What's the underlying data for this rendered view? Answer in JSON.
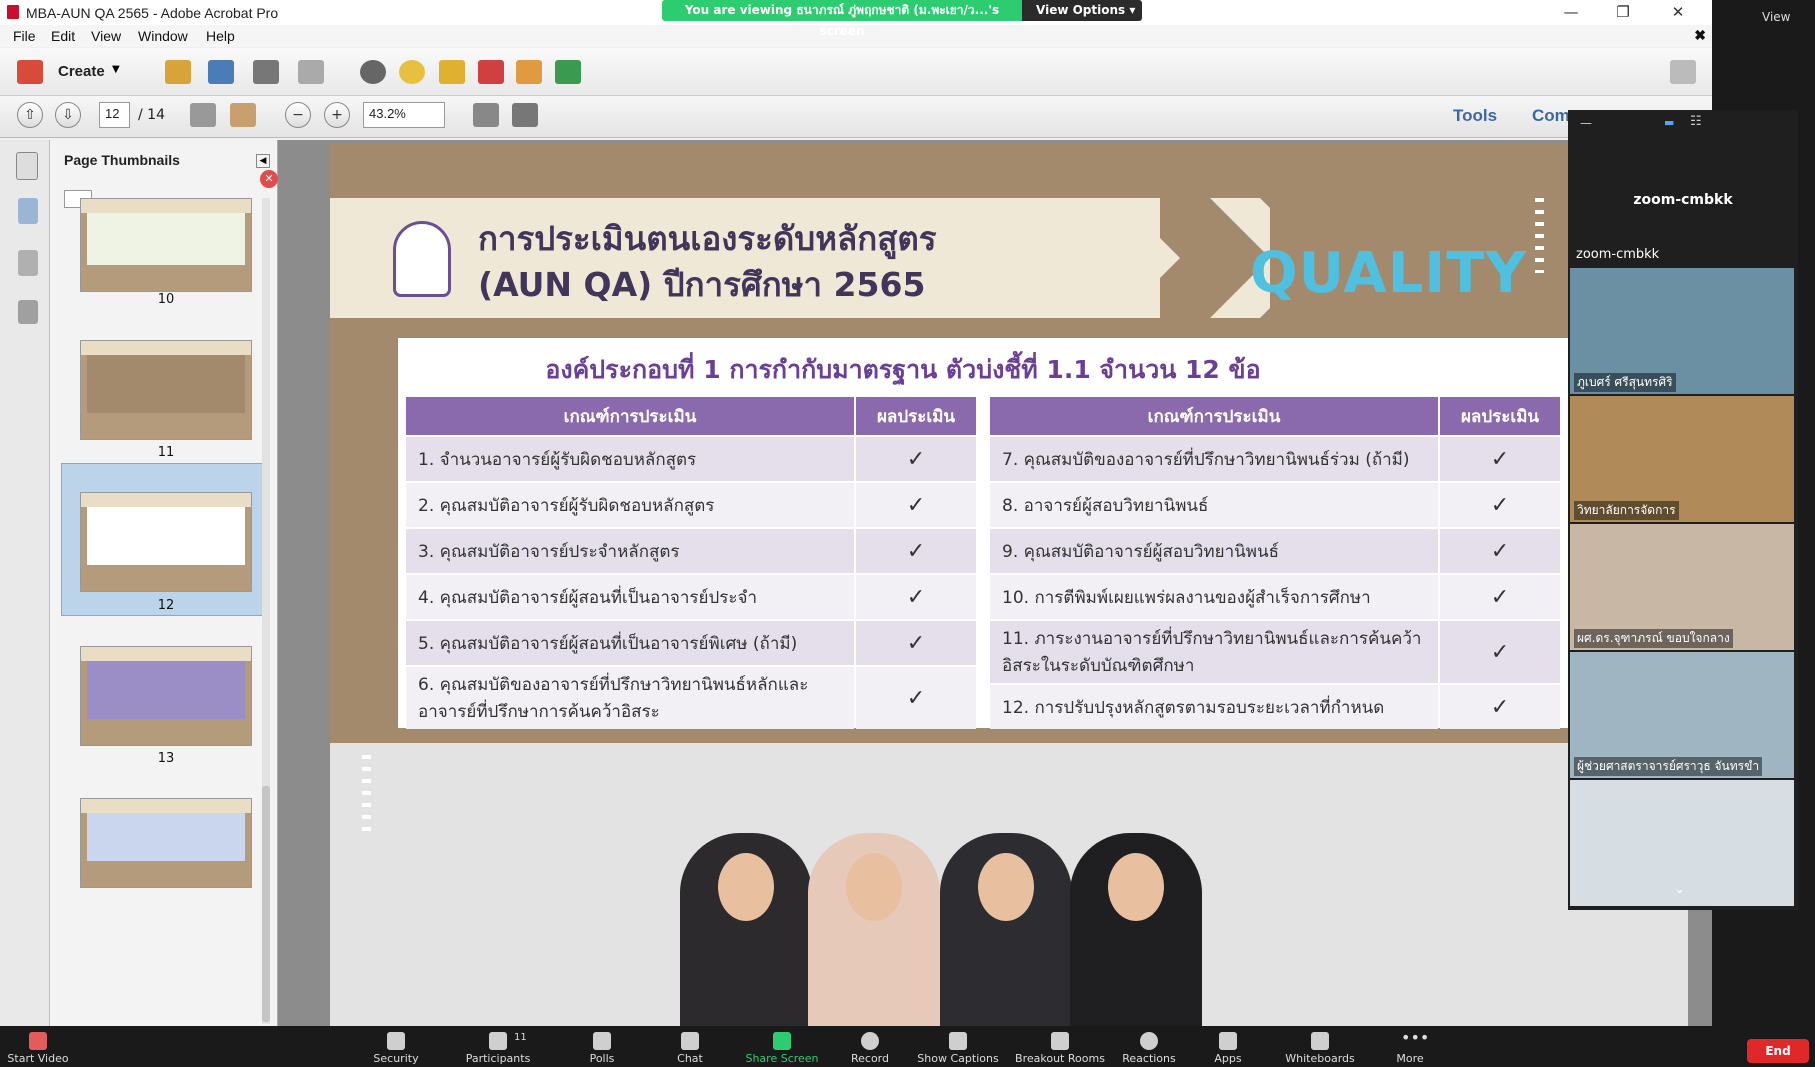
{
  "window": {
    "title": "MBA-AUN QA 2565 - Adobe Acrobat Pro"
  },
  "menu": [
    "File",
    "Edit",
    "View",
    "Window",
    "Help"
  ],
  "toolbar": {
    "create_label": "Create",
    "page_current": "12",
    "page_total": "/ 14",
    "zoom": "43.2%",
    "tools": "Tools",
    "comment": "Com"
  },
  "thumbnails": {
    "title": "Page Thumbnails",
    "pages": [
      "10",
      "11",
      "12",
      "13"
    ],
    "selected": "12"
  },
  "slide": {
    "title_line1": "การประเมินตนเองระดับหลักสูตร",
    "title_line2": "(AUN QA) ปีการศึกษา 2565",
    "quality_word": "QUALITY",
    "heading": "องค์ประกอบที่ 1 การกำกับมาตรฐาน ตัวบ่งชี้ที่ 1.1 จำนวน 12 ข้อ",
    "col_criteria": "เกณฑ์การประเมิน",
    "col_result": "ผลประเมิน",
    "check": "✓",
    "left_rows": [
      "1. จำนวนอาจารย์ผู้รับผิดชอบหลักสูตร",
      "2. คุณสมบัติอาจารย์ผู้รับผิดชอบหลักสูตร",
      "3. คุณสมบัติอาจารย์ประจำหลักสูตร",
      "4. คุณสมบัติอาจารย์ผู้สอนที่เป็นอาจารย์ประจำ",
      "5. คุณสมบัติอาจารย์ผู้สอนที่เป็นอาจารย์พิเศษ (ถ้ามี)",
      "6. คุณสมบัติของอาจารย์ที่ปรึกษาวิทยานิพนธ์หลักและอาจารย์ที่ปรึกษาการค้นคว้าอิสระ"
    ],
    "right_rows": [
      "7. คุณสมบัติของอาจารย์ที่ปรึกษาวิทยานิพนธ์ร่วม (ถ้ามี)",
      "8. อาจารย์ผู้สอบวิทยานิพนธ์",
      "9. คุณสมบัติอาจารย์ผู้สอบวิทยานิพนธ์",
      "10. การตีพิมพ์เผยแพร่ผลงานของผู้สำเร็จการศึกษา",
      "11. ภาระงานอาจารย์ที่ปรึกษาวิทยานิพนธ์และการค้นคว้าอิสระในระดับบัณฑิตศึกษา",
      "12. การปรับปรุงหลักสูตรตามรอบระยะเวลาที่กำหนด"
    ]
  },
  "zoom": {
    "sharing_banner": "You are viewing ธนาภรณ์ ภู่พฤกษชาติ (ม.พะเยา/ว...'s screen",
    "view_options": "View Options",
    "view_label": "View",
    "gallery_title": "zoom-cmbkk",
    "host_name": "zoom-cmbkk",
    "participants": [
      {
        "name": "ภูเบศร์ ศรีสุนทรศิริ",
        "bg": "#6b8fa3"
      },
      {
        "name": "วิทยาลัยการจัดการ",
        "bg": "#b08a58"
      },
      {
        "name": "ผศ.ดร.จุฑาภรณ์ ขอบใจกลาง",
        "bg": "#c9b7a6"
      },
      {
        "name": "ผู้ช่วยศาสตราจารย์ศราวุธ จันทรขำ",
        "bg": "#9fb5c2"
      },
      {
        "name": "",
        "bg": "#d6dde3"
      }
    ],
    "controls": [
      "Start Video",
      "Security",
      "Participants",
      "Polls",
      "Chat",
      "Share Screen",
      "Record",
      "Show Captions",
      "Breakout Rooms",
      "Reactions",
      "Apps",
      "Whiteboards",
      "More"
    ],
    "participants_count": "11",
    "end": "End"
  }
}
